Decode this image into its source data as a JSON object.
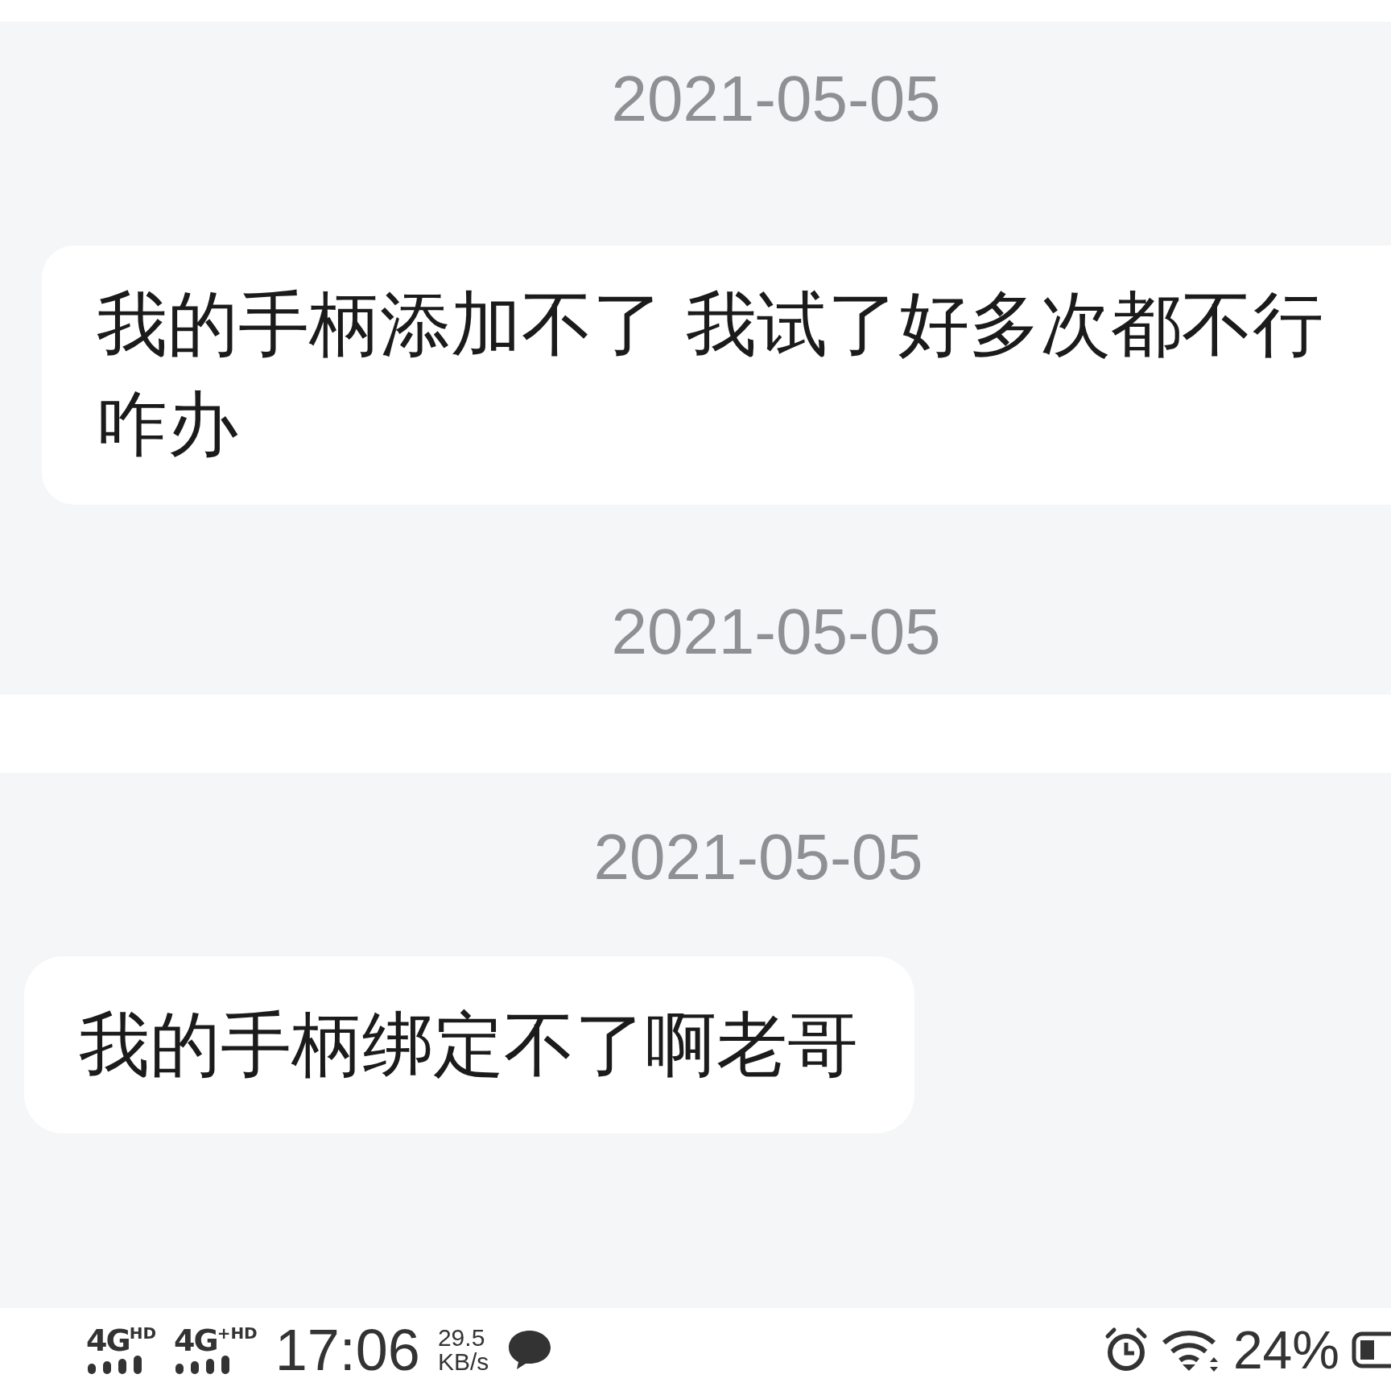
{
  "panels": [
    {
      "items": [
        {
          "kind": "date",
          "text": "2021-05-05"
        },
        {
          "kind": "message",
          "text": "我的手柄添加不了 我试了好多次都不行咋办"
        },
        {
          "kind": "date",
          "text": "2021-05-05"
        }
      ]
    },
    {
      "items": [
        {
          "kind": "date",
          "text": "2021-05-05"
        },
        {
          "kind": "message",
          "text": "我的手柄绑定不了啊老哥"
        }
      ]
    }
  ],
  "status_bar": {
    "signals": [
      {
        "network": "4G",
        "tag": "HD"
      },
      {
        "network": "4G",
        "tag": "+HD"
      }
    ],
    "time": "17:06",
    "speed": "29.5",
    "speed_unit": "KB/s",
    "battery": "24%"
  }
}
